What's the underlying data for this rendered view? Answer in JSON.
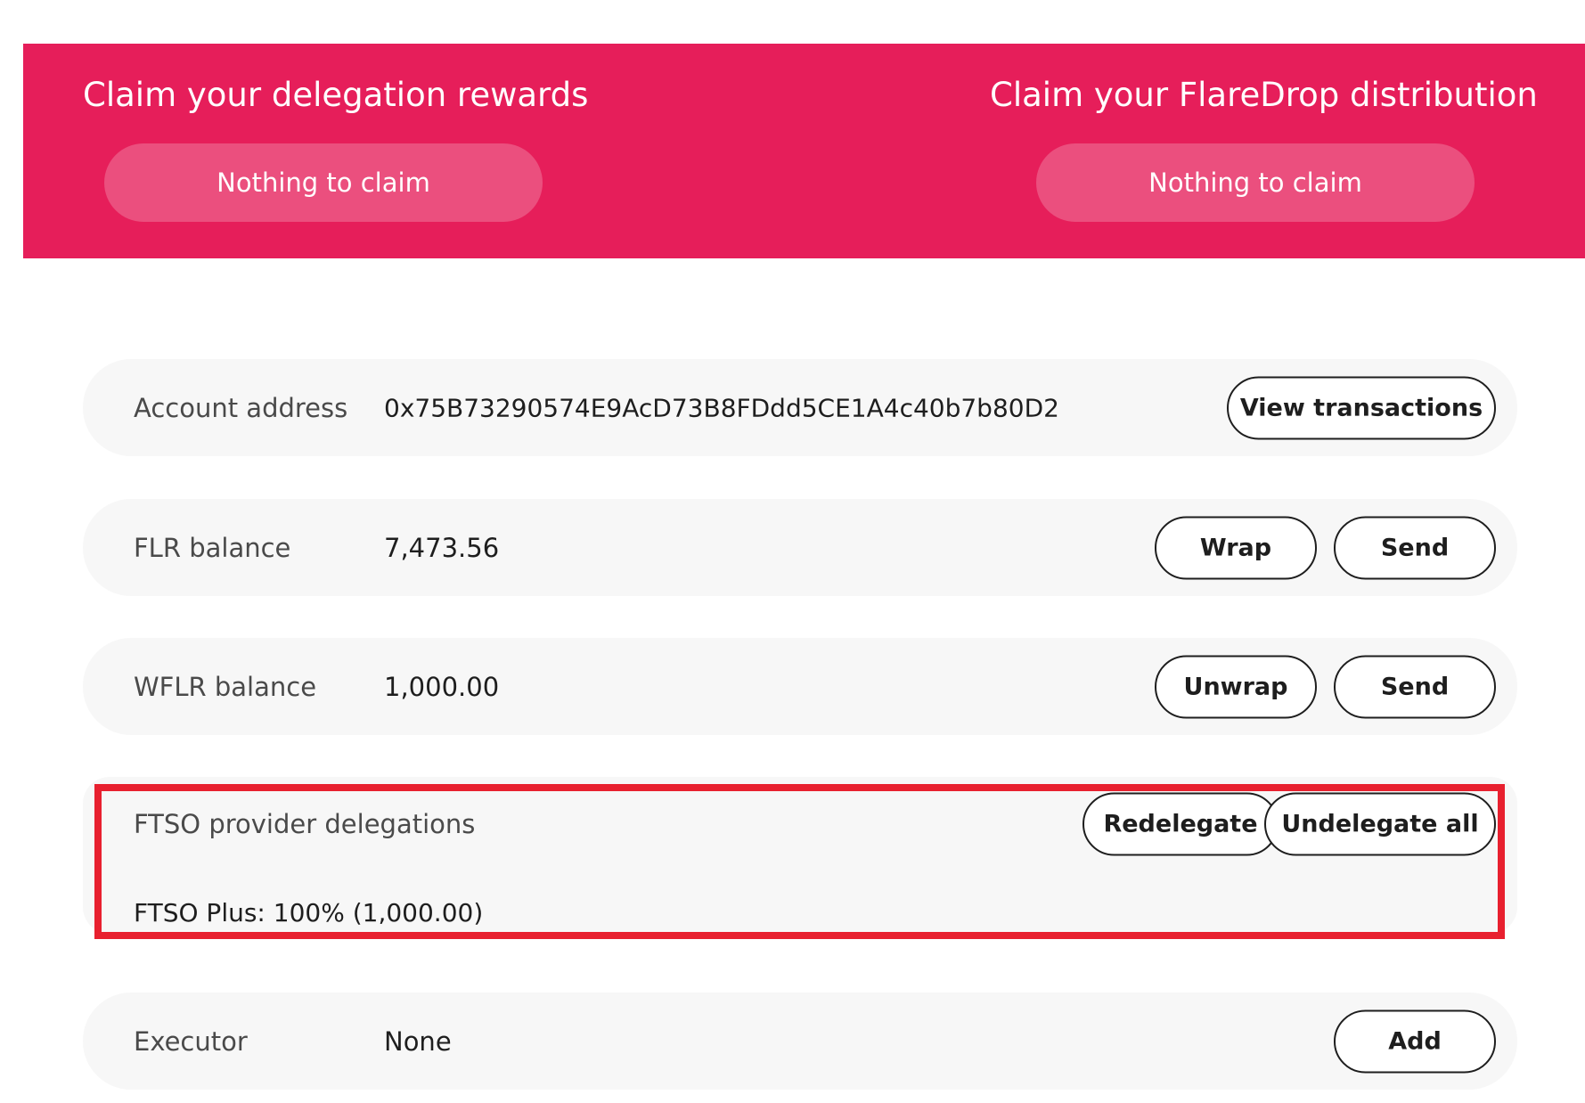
{
  "banner": {
    "background_color": "#e61e5a",
    "delegation": {
      "title": "Claim your delegation rewards",
      "button_label": "Nothing to claim"
    },
    "flaredrop": {
      "title": "Claim your FlareDrop distribution",
      "button_label": "Nothing to claim"
    }
  },
  "account": {
    "label": "Account address",
    "value": "0x75B73290574E9AcD73B8FDdd5CE1A4c40b7b80D2",
    "view_transactions_label": "View transactions"
  },
  "flr": {
    "label": "FLR balance",
    "value": "7,473.56",
    "wrap_label": "Wrap",
    "send_label": "Send"
  },
  "wflr": {
    "label": "WFLR balance",
    "value": "1,000.00",
    "unwrap_label": "Unwrap",
    "send_label": "Send"
  },
  "delegations": {
    "label": "FTSO provider delegations",
    "redelegate_label": "Redelegate",
    "undelegate_all_label": "Undelegate all",
    "entries": [
      "FTSO Plus: 100% (1,000.00)"
    ],
    "highlight_color": "#e8202f"
  },
  "executor": {
    "label": "Executor",
    "value": "None",
    "add_label": "Add"
  }
}
